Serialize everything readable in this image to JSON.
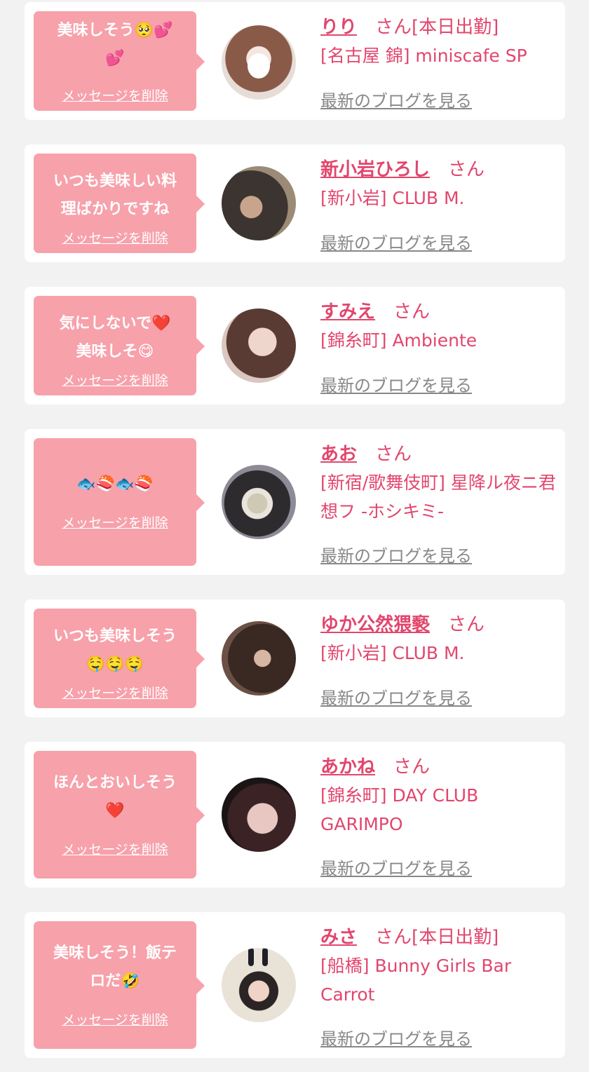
{
  "delete_label": "メッセージを削除",
  "blog_label": "最新のブログを見る",
  "san_label": "さん",
  "colors": {
    "accent": "#e2466d",
    "bubble": "#f7a1ab",
    "background": "#f2f2f2"
  },
  "items": [
    {
      "message": "美味しそう🥺💕\n💕",
      "name": "りり",
      "suffix": "[本日出勤]",
      "shop": "[名古屋 錦] miniscafe SP"
    },
    {
      "message": "いつも美味しい料\n理ばかりですね",
      "name": "新小岩ひろし",
      "suffix": "",
      "shop": "[新小岩] CLUB M."
    },
    {
      "message": "気にしないで❤️\n美味しそ😋",
      "name": "すみえ",
      "suffix": "",
      "shop": "[錦糸町] Ambiente"
    },
    {
      "message": "🐟🍣🐟🍣",
      "name": "あお",
      "suffix": "",
      "shop": "[新宿/歌舞伎町] 星降ル夜ニ君想フ -ホシキミ-"
    },
    {
      "message": "いつも美味しそう\n🤤🤤🤤",
      "name": "ゆか公然猥褻",
      "suffix": "",
      "shop": "[新小岩] CLUB M."
    },
    {
      "message": "ほんとおいしそう\n❤️",
      "name": "あかね",
      "suffix": "",
      "shop": "[錦糸町] DAY CLUB GARIMPO"
    },
    {
      "message": "美味しそう！飯テ\nロだ🤣",
      "name": "みさ",
      "suffix": "[本日出勤]",
      "shop": "[船橋] Bunny Girls Bar Carrot"
    }
  ]
}
